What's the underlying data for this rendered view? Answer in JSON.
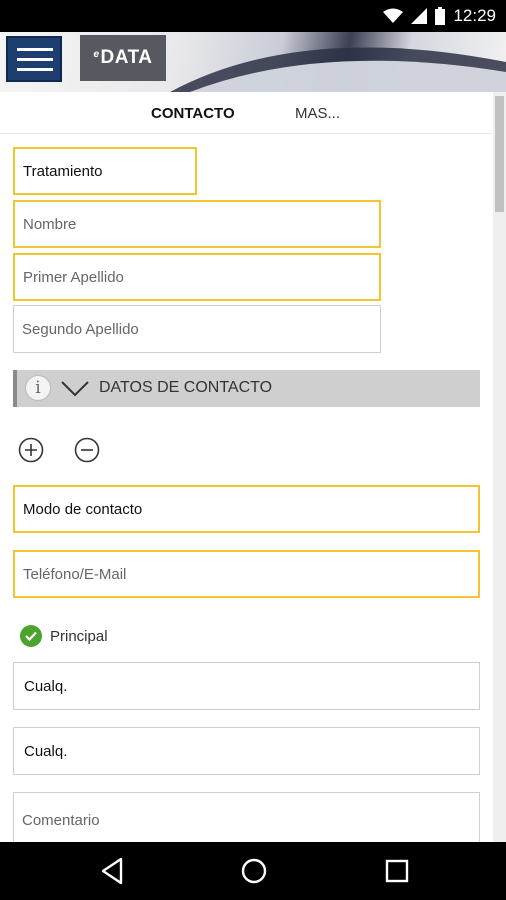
{
  "status_bar": {
    "time": "12:29"
  },
  "app_bar": {
    "logo_text": "DATA",
    "logo_prefix": "e"
  },
  "tabs": [
    {
      "label": "CONTACTO",
      "active": true
    },
    {
      "label": "MAS...",
      "active": false
    }
  ],
  "form": {
    "tratamiento": "Tratamiento",
    "nombre_placeholder": "Nombre",
    "primer_apellido_placeholder": "Primer Apellido",
    "segundo_apellido_placeholder": "Segundo Apellido"
  },
  "section": {
    "title": "DATOS DE CONTACTO",
    "info_glyph": "i"
  },
  "contact": {
    "modo_contacto": "Modo de contacto",
    "telefono_placeholder": "Teléfono/E-Mail",
    "principal_label": "Principal",
    "cualq_1": "Cualq.",
    "cualq_2": "Cualq.",
    "comentario_placeholder": "Comentario"
  },
  "colors": {
    "accent_yellow": "#f4c430",
    "menu_blue": "#1d3e6e",
    "check_green": "#4ca32d"
  }
}
